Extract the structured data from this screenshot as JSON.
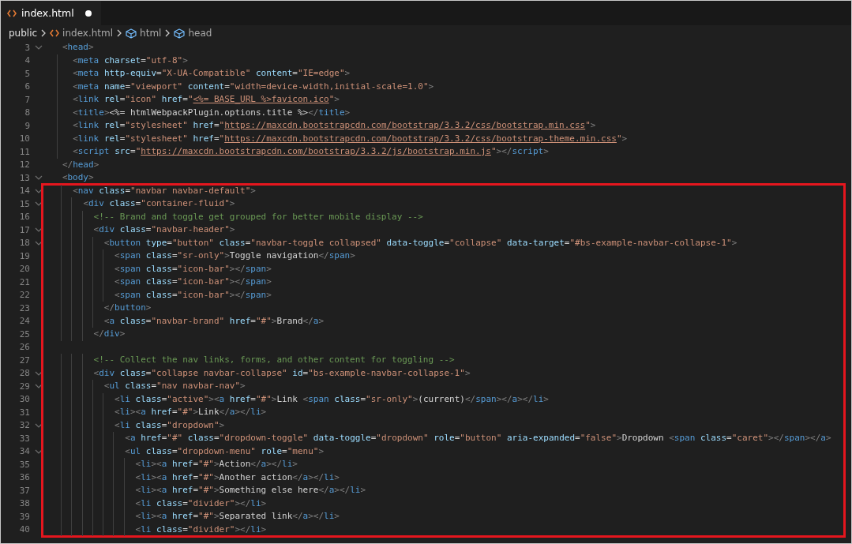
{
  "tab": {
    "label": "index.html",
    "modified": true,
    "selected": true
  },
  "breadcrumb": [
    {
      "kind": "folder",
      "label": "public"
    },
    {
      "kind": "file",
      "label": "index.html"
    },
    {
      "kind": "symbol",
      "label": "html"
    },
    {
      "kind": "symbol",
      "label": "head"
    }
  ],
  "code": [
    {
      "highlighted": false,
      "lines": [
        {
          "number": "3",
          "foldable": true,
          "text": "  <head>"
        },
        {
          "number": "4",
          "foldable": false,
          "text": "    <meta charset=\"utf-8\">"
        },
        {
          "number": "5",
          "foldable": false,
          "text": "    <meta http-equiv=\"X-UA-Compatible\" content=\"IE=edge\">"
        },
        {
          "number": "6",
          "foldable": false,
          "text": "    <meta name=\"viewport\" content=\"width=device-width,initial-scale=1.0\">"
        },
        {
          "number": "7",
          "foldable": false,
          "text": "    <link rel=\"icon\" href=\"<%= BASE_URL %>favicon.ico\">"
        },
        {
          "number": "8",
          "foldable": false,
          "text": "    <title><%= htmlWebpackPlugin.options.title %></title>"
        },
        {
          "number": "9",
          "foldable": false,
          "text": "    <link rel=\"stylesheet\" href=\"https://maxcdn.bootstrapcdn.com/bootstrap/3.3.2/css/bootstrap.min.css\">"
        },
        {
          "number": "10",
          "foldable": false,
          "text": "    <link rel=\"stylesheet\" href=\"https://maxcdn.bootstrapcdn.com/bootstrap/3.3.2/css/bootstrap-theme.min.css\">"
        },
        {
          "number": "11",
          "foldable": false,
          "text": "    <script src=\"https://maxcdn.bootstrapcdn.com/bootstrap/3.3.2/js/bootstrap.min.js\"></script>"
        },
        {
          "number": "12",
          "foldable": false,
          "text": "  </head>"
        },
        {
          "number": "13",
          "foldable": true,
          "text": "  <body>"
        }
      ]
    },
    {
      "highlighted": true,
      "lines": [
        {
          "number": "14",
          "foldable": true,
          "text": "    <nav class=\"navbar navbar-default\">"
        },
        {
          "number": "15",
          "foldable": true,
          "text": "      <div class=\"container-fluid\">"
        },
        {
          "number": "16",
          "foldable": false,
          "text": "        <!-- Brand and toggle get grouped for better mobile display -->"
        },
        {
          "number": "17",
          "foldable": true,
          "text": "        <div class=\"navbar-header\">"
        },
        {
          "number": "18",
          "foldable": true,
          "text": "          <button type=\"button\" class=\"navbar-toggle collapsed\" data-toggle=\"collapse\" data-target=\"#bs-example-navbar-collapse-1\">"
        },
        {
          "number": "19",
          "foldable": false,
          "text": "            <span class=\"sr-only\">Toggle navigation</span>"
        },
        {
          "number": "20",
          "foldable": false,
          "text": "            <span class=\"icon-bar\"></span>"
        },
        {
          "number": "21",
          "foldable": false,
          "text": "            <span class=\"icon-bar\"></span>"
        },
        {
          "number": "22",
          "foldable": false,
          "text": "            <span class=\"icon-bar\"></span>"
        },
        {
          "number": "23",
          "foldable": false,
          "text": "          </button>"
        },
        {
          "number": "24",
          "foldable": false,
          "text": "          <a class=\"navbar-brand\" href=\"#\">Brand</a>"
        },
        {
          "number": "25",
          "foldable": false,
          "text": "        </div>"
        },
        {
          "number": "26",
          "foldable": false
        },
        {
          "number": "27",
          "foldable": false,
          "text": "        <!-- Collect the nav links, forms, and other content for toggling -->"
        },
        {
          "number": "28",
          "foldable": true,
          "text": "        <div class=\"collapse navbar-collapse\" id=\"bs-example-navbar-collapse-1\">"
        },
        {
          "number": "29",
          "foldable": true,
          "text": "          <ul class=\"nav navbar-nav\">"
        },
        {
          "number": "30",
          "foldable": false,
          "text": "            <li class=\"active\"><a href=\"#\">Link <span class=\"sr-only\">(current)</span></a></li>"
        },
        {
          "number": "31",
          "foldable": false,
          "text": "            <li><a href=\"#\">Link</a></li>"
        },
        {
          "number": "32",
          "foldable": true,
          "text": "            <li class=\"dropdown\">"
        },
        {
          "number": "33",
          "foldable": false,
          "text": "              <a href=\"#\" class=\"dropdown-toggle\" data-toggle=\"dropdown\" role=\"button\" aria-expanded=\"false\">Dropdown <span class=\"caret\"></span></a>"
        },
        {
          "number": "34",
          "foldable": true,
          "text": "              <ul class=\"dropdown-menu\" role=\"menu\">"
        },
        {
          "number": "35",
          "foldable": false,
          "text": "                <li><a href=\"#\">Action</a></li>"
        },
        {
          "number": "36",
          "foldable": false,
          "text": "                <li><a href=\"#\">Another action</a></li>"
        },
        {
          "number": "37",
          "foldable": false,
          "text": "                <li><a href=\"#\">Something else here</a></li>"
        },
        {
          "number": "38",
          "foldable": false,
          "text": "                <li class=\"divider\"></li>"
        },
        {
          "number": "39",
          "foldable": false,
          "text": "                <li><a href=\"#\">Separated link</a></li>"
        },
        {
          "number": "40",
          "foldable": false,
          "text": "                <li class=\"divider\"></li>"
        }
      ]
    }
  ]
}
